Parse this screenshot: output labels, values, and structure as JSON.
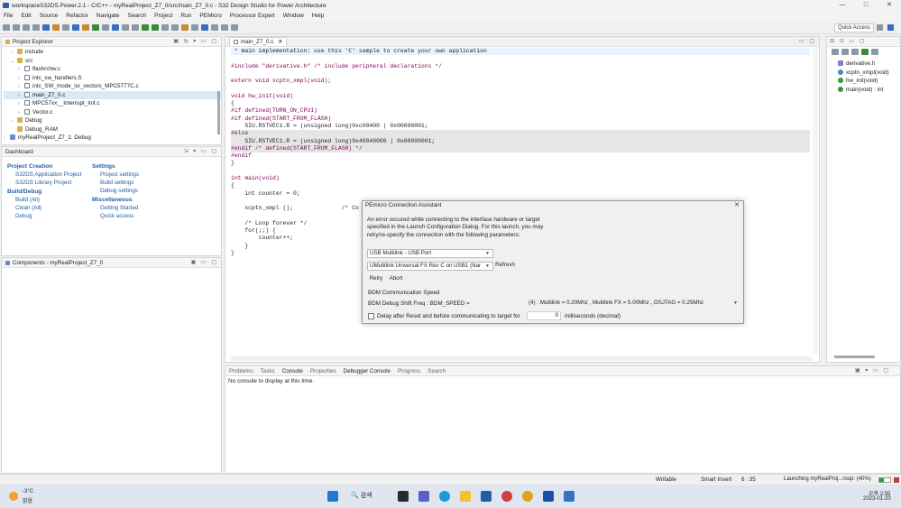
{
  "window": {
    "title": "workspaceS32DS.Power.2.1 - C/C++ - myRealProject_Z7_0/src/main_Z7_0.c - S32 Design Studio for Power Architecture",
    "controls": [
      "—",
      "□",
      "✕"
    ]
  },
  "menu": [
    "File",
    "Edit",
    "Source",
    "Refactor",
    "Navigate",
    "Search",
    "Project",
    "Run",
    "PEMicro",
    "Processor Expert",
    "Window",
    "Help"
  ],
  "toolbar": {
    "quick_access": "Quick Access"
  },
  "project_explorer": {
    "title": "Project Explorer",
    "items": [
      {
        "label": "include",
        "kind": "folder",
        "indent": 1,
        "arrow": "›"
      },
      {
        "label": "src",
        "kind": "folder",
        "indent": 1,
        "arrow": "⌄"
      },
      {
        "label": "flashrchw.c",
        "kind": "file",
        "indent": 2,
        "arrow": "›"
      },
      {
        "label": "intc_sw_handlers.S",
        "kind": "file",
        "indent": 2,
        "arrow": "›"
      },
      {
        "label": "intc_SW_mode_isr_vectors_MPC5777C.c",
        "kind": "file",
        "indent": 2,
        "arrow": "›"
      },
      {
        "label": "main_Z7_0.c",
        "kind": "file",
        "indent": 2,
        "arrow": "›",
        "selected": true
      },
      {
        "label": "MPC57xx__Interrupt_Init.c",
        "kind": "file",
        "indent": 2,
        "arrow": "›"
      },
      {
        "label": "Vector.c",
        "kind": "file",
        "indent": 2,
        "arrow": "›"
      },
      {
        "label": "Debug",
        "kind": "folder",
        "indent": 1,
        "arrow": "›"
      },
      {
        "label": "Debug_RAM",
        "kind": "folder",
        "indent": 1,
        "arrow": ""
      },
      {
        "label": "myRealProject_Z7_1: Debug",
        "kind": "proj",
        "indent": 0,
        "arrow": "›"
      }
    ]
  },
  "dashboard": {
    "title": "Dashboard",
    "sections": {
      "project_creation": {
        "title": "Project Creation",
        "links": [
          "S32DS Application Project",
          "S32DS Library Project"
        ]
      },
      "settings": {
        "title": "Settings",
        "links": [
          "Project settings",
          "Build settings",
          "Debug settings"
        ]
      },
      "build_debug": {
        "title": "Build/Debug",
        "links": [
          "Build  (All)",
          "Clean  (All)",
          "Debug"
        ]
      },
      "misc": {
        "title": "Miscellaneous",
        "links": [
          "Getting Started",
          "Quick access"
        ]
      }
    }
  },
  "components": {
    "title": "Components - myRealProject_Z7_0"
  },
  "editor": {
    "tab": "main_Z7_0.c",
    "lines": [
      {
        "t": " * main implementation: use this 'C' sample to create your own application",
        "c": "cm",
        "hl": true
      },
      {
        "t": "",
        "c": ""
      },
      {
        "t": "#include \"derivative.h\" /* include peripheral declarations */",
        "c": "inc"
      },
      {
        "t": "",
        "c": ""
      },
      {
        "t": "extern void xcptn_xmpl(void);",
        "c": "ext"
      },
      {
        "t": "",
        "c": ""
      },
      {
        "t": "void hw_init(void)",
        "c": "fn"
      },
      {
        "t": "{",
        "c": ""
      },
      {
        "t": "#if defined(TURN_ON_CPU1)",
        "c": "pp"
      },
      {
        "t": "#if defined(START_FROM_FLASH)",
        "c": "pp"
      },
      {
        "t": "    SIU.RSTVEC1.R = (unsigned long)0xc00400 | 0x00000001;",
        "c": ""
      },
      {
        "t": "#else",
        "c": "pp",
        "grey": true
      },
      {
        "t": "    SIU.RSTVEC1.R = (unsigned long)0x40040000 | 0x00000001;",
        "c": "",
        "grey": true
      },
      {
        "t": "#endif /* defined(START_FROM_FLASH) */",
        "c": "pp",
        "grey": true
      },
      {
        "t": "#endif",
        "c": "pp"
      },
      {
        "t": "}",
        "c": ""
      },
      {
        "t": "",
        "c": ""
      },
      {
        "t": "int main(void)",
        "c": "fn"
      },
      {
        "t": "{",
        "c": ""
      },
      {
        "t": "    int counter = 0;",
        "c": ""
      },
      {
        "t": "",
        "c": ""
      },
      {
        "t": "    xcptn_xmpl ();              /* Co",
        "c": ""
      },
      {
        "t": "",
        "c": ""
      },
      {
        "t": "    /* Loop forever */",
        "c": "cm"
      },
      {
        "t": "    for(;;) {",
        "c": ""
      },
      {
        "t": "        counter++;",
        "c": ""
      },
      {
        "t": "    }",
        "c": ""
      },
      {
        "t": "}",
        "c": ""
      }
    ]
  },
  "outline": {
    "items": [
      "derivative.h",
      "xcptn_xmpl(void)",
      "hw_init(void)",
      "main(void) : int"
    ]
  },
  "dialog": {
    "title": "PEmicro Connection Assistant",
    "message": "An error occured while connecting to the interface hardware or target specified in the Launch Configuration Dialog. For this launch, you may retry/re-specify the connection with the following parameters:",
    "port_type": "USB Multilink - USB Port",
    "port": "UMultilink Universal FX Rev C on USB1 (Nar",
    "refresh": "Refresh",
    "retry": "Retry",
    "abort": "Abort",
    "bdm_label": "BDM Communication Speed",
    "bdm_freq_label": "BDM Debug Shift Freq : BDM_SPEED =",
    "bdm_freq_value": "(4)  :  Multilink = 0.20Mhz  ,  Multilink FX = 5.00Mhz  ,  OSJTAG = 0.25Mhz",
    "delay_label": "Delay after Reset and before communicating to target for",
    "delay_value": "0",
    "delay_unit": "milliseconds (decimal)"
  },
  "bottom": {
    "tabs": [
      "Problems",
      "Tasks",
      "Console",
      "Properties",
      "Debugger Console",
      "Progress",
      "Search"
    ],
    "message": "No console to display at this time."
  },
  "status": {
    "writable": "Writable",
    "insert": "Smart Insert",
    "pos": "6 : 35",
    "launch": "Launching myRealProj...roup: (40%)",
    "progress": 0.4
  },
  "taskbar": {
    "weather_temp": "-3°C",
    "weather_desc": "맑음",
    "search": "검색",
    "time_ampm": "오후 2:55",
    "date": "2023-01-20"
  }
}
